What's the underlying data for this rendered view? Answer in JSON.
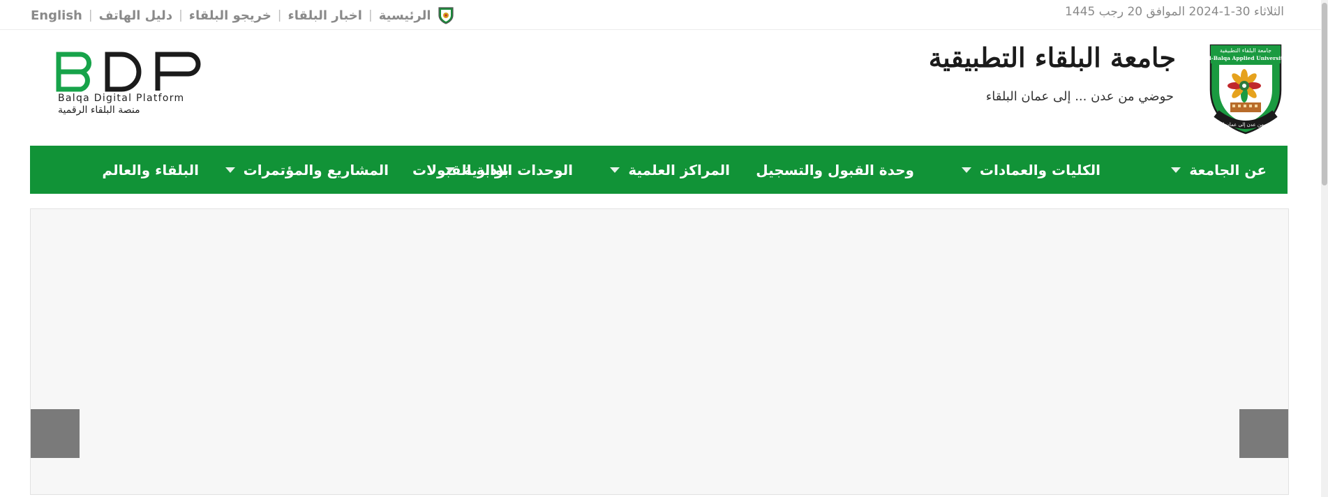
{
  "topbar": {
    "links": [
      "English",
      "دليل الهاتف",
      "خريجو البلقاء",
      "اخبار البلقاء",
      "الرئيسية"
    ],
    "separator": "|",
    "date": "الثلاثاء 30-1-2024 الموافق 20 رجب 1445"
  },
  "header": {
    "university_name": "جامعة البلقاء التطبيقية",
    "slogan": "حوضي من عدن ... إلى عمان البلقاء",
    "emblem": {
      "top_ar": "جامعة البلقاء التطبيقية",
      "top_en": "Al-Balqa Applied University",
      "bottom_ar": "حوضي من عدن إلى عمان البلقاء"
    },
    "platform_logo": {
      "letters": "BDP",
      "subtitle_en": "Balqa Digital Platform",
      "subtitle_ar": "منصة البلقاء الرقمية"
    }
  },
  "nav": {
    "items": [
      {
        "label": "عن الجامعة",
        "dropdown": true
      },
      {
        "label": "الكليات والعمادات",
        "dropdown": true
      },
      {
        "label": "وحدة القبول والتسجيل",
        "dropdown": false
      },
      {
        "label": "المراكز العلمية",
        "dropdown": true
      },
      {
        "label": "الوحدات الادارية",
        "dropdown": true
      },
      {
        "label": "بوابة القبولات",
        "dropdown": false
      },
      {
        "label": "المشاريع والمؤتمرات",
        "dropdown": true
      },
      {
        "label": "البلقاء والعالم",
        "dropdown": false
      }
    ]
  },
  "colors": {
    "nav_green": "#119337",
    "text_gray": "#8a8a8a",
    "slider_bg": "#f7f7f7",
    "slider_button": "#7a7a7a"
  },
  "icons": {
    "home": "university-shield-icon",
    "dropdown": "caret-down-icon"
  }
}
